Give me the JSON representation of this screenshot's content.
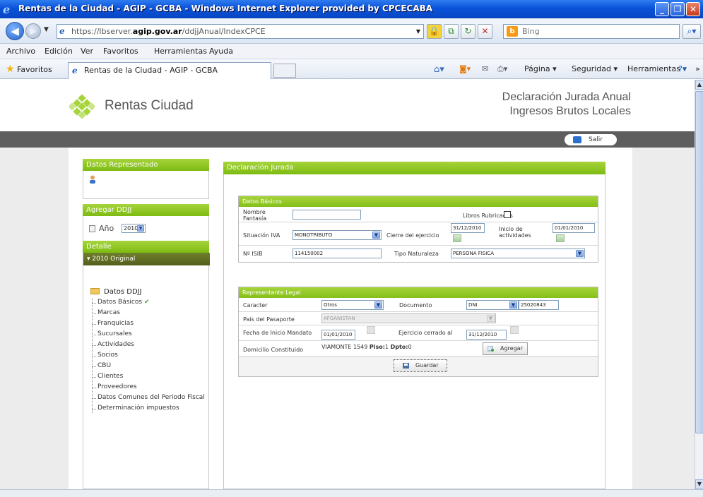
{
  "window": {
    "title": "Rentas de la Ciudad - AGIP - GCBA - Windows Internet Explorer provided by CPCECABA",
    "url_protocol": "https://lbserver.",
    "url_host": "agip.gov.ar",
    "url_path": "/ddjjAnual/IndexCPCE",
    "search_placeholder": "Bing"
  },
  "menu": [
    "Archivo",
    "Edición",
    "Ver",
    "Favoritos",
    "Herramientas",
    "Ayuda"
  ],
  "favbar": {
    "favorites_label": "Favoritos",
    "tab_title": "Rentas de la Ciudad - AGIP - GCBA",
    "tools": [
      "Página ▾",
      "Seguridad ▾",
      "Herramientas ▾"
    ]
  },
  "header": {
    "logo_text": "Rentas Ciudad",
    "title_line1": "Declaración Jurada Anual",
    "title_line2": "Ingresos Brutos Locales",
    "logout_label": "Salir"
  },
  "sidebar": {
    "represented_header": "Datos Representado",
    "add_header": "Agregar DDJJ",
    "year_label": "Año",
    "year_value": "2010",
    "detail_header": "Detalle",
    "selected_decl": "▾ 2010 Original",
    "folder_label": "Datos DDJJ",
    "items": [
      "Datos Básicos",
      "Marcas",
      "Franquicias",
      "Sucursales",
      "Actividades",
      "Socios",
      "CBU",
      "Clientes",
      "Proveedores",
      "Datos Comunes del Periodo Fiscal",
      "Determinación impuestos"
    ]
  },
  "main": {
    "header": "Declaración Jurada",
    "basic": {
      "title": "Datos Básicos",
      "nombre_fantasia_label": "Nombre Fantasía",
      "nombre_fantasia_value": "",
      "libros_label": "Libros Rubricados",
      "situacion_iva_label": "Situación IVA",
      "situacion_iva_value": "MONOTRIBUTO",
      "cierre_label": "Cierre del ejercicio",
      "cierre_value": "31/12/2010",
      "inicio_label": "Inicio de actividades",
      "inicio_value": "01/01/2010",
      "nro_isib_label": "Nº ISIB",
      "nro_isib_value": "114150002",
      "tipo_naturaleza_label": "Tipo Naturaleza",
      "tipo_naturaleza_value": "PERSONA FISICA"
    },
    "legal": {
      "title": "Representante Legal",
      "caracter_label": "Caracter",
      "caracter_value": "Otros",
      "documento_label": "Documento",
      "documento_type": "DNI",
      "documento_number": "25020843",
      "pais_label": "País del Pasaporte",
      "pais_value": "AFGANISTAN",
      "fecha_inicio_label": "Fecha de Inicio Mandato",
      "fecha_inicio_value": "01/01/2010",
      "ejercicio_label": "Ejercicio cerrado al",
      "ejercicio_value": "31/12/2010",
      "domicilio_label": "Domicilio Constituido",
      "domicilio_street": "VIAMONTE 1549",
      "piso_label": "Piso:",
      "piso_value": "1",
      "dpto_label": "Dpto:",
      "dpto_value": "0",
      "add_label": "Agregar",
      "save_label": "Guardar"
    }
  }
}
